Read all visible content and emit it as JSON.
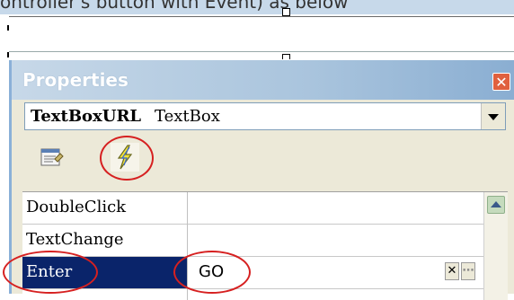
{
  "background": {
    "caption": "ontroller's button with Event) as below"
  },
  "properties_window": {
    "title": "Properties",
    "close_glyph": "✕",
    "selected_object": {
      "name": "TextBoxURL",
      "type": "TextBox"
    },
    "toolbar": {
      "properties_icon": "property-pages-icon",
      "events_icon": "lightning-bolt-icon"
    },
    "events": [
      {
        "name": "DoubleClick",
        "value": ""
      },
      {
        "name": "TextChange",
        "value": ""
      },
      {
        "name": "Enter",
        "value": "GO",
        "selected": true
      }
    ],
    "value_buttons": {
      "clear": "✕",
      "ellipsis": "⋯"
    },
    "colors": {
      "header": "#a9c4dd",
      "selection": "#0a246a",
      "highlight_circle": "#d62020",
      "panel": "#ece9d8"
    }
  }
}
